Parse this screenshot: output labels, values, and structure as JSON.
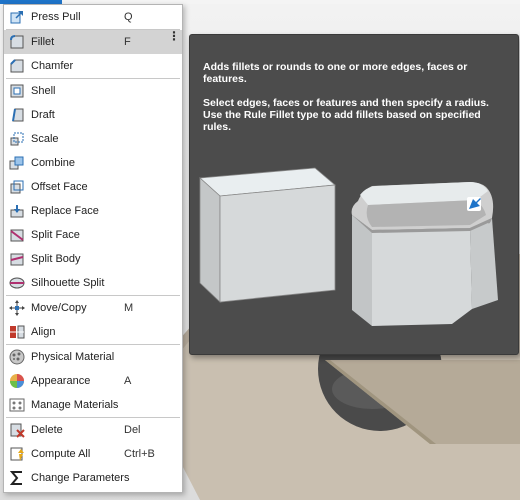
{
  "menu": {
    "items": [
      {
        "label": "Press Pull",
        "shortcut": "Q",
        "icon": "press-pull-icon"
      },
      {
        "label": "Fillet",
        "shortcut": "F",
        "icon": "fillet-icon",
        "more": "⋮"
      },
      {
        "label": "Chamfer",
        "shortcut": "",
        "icon": "chamfer-icon"
      },
      {
        "label": "Shell",
        "shortcut": "",
        "icon": "shell-icon"
      },
      {
        "label": "Draft",
        "shortcut": "",
        "icon": "draft-icon"
      },
      {
        "label": "Scale",
        "shortcut": "",
        "icon": "scale-icon"
      },
      {
        "label": "Combine",
        "shortcut": "",
        "icon": "combine-icon"
      },
      {
        "label": "Offset Face",
        "shortcut": "",
        "icon": "offset-face-icon"
      },
      {
        "label": "Replace Face",
        "shortcut": "",
        "icon": "replace-face-icon"
      },
      {
        "label": "Split Face",
        "shortcut": "",
        "icon": "split-face-icon"
      },
      {
        "label": "Split Body",
        "shortcut": "",
        "icon": "split-body-icon"
      },
      {
        "label": "Silhouette Split",
        "shortcut": "",
        "icon": "silhouette-split-icon"
      },
      {
        "label": "Move/Copy",
        "shortcut": "M",
        "icon": "move-copy-icon"
      },
      {
        "label": "Align",
        "shortcut": "",
        "icon": "align-icon"
      },
      {
        "label": "Physical Material",
        "shortcut": "",
        "icon": "physical-material-icon"
      },
      {
        "label": "Appearance",
        "shortcut": "A",
        "icon": "appearance-icon"
      },
      {
        "label": "Manage Materials",
        "shortcut": "",
        "icon": "manage-materials-icon"
      },
      {
        "label": "Delete",
        "shortcut": "Del",
        "icon": "delete-icon"
      },
      {
        "label": "Compute All",
        "shortcut": "Ctrl+B",
        "icon": "compute-all-icon"
      },
      {
        "label": "Change Parameters",
        "shortcut": "",
        "icon": "change-parameters-icon"
      }
    ]
  },
  "tooltip": {
    "summary": "Adds fillets or rounds to one or more edges, faces or features.",
    "details": "Select edges, faces or features and then specify a radius. Use the Rule Fillet type to add fillets based on specified rules."
  },
  "colors": {
    "hover": "#d3d3d3",
    "tooltip_bg": "#4c4c4c",
    "accent": "#1f74c9"
  }
}
